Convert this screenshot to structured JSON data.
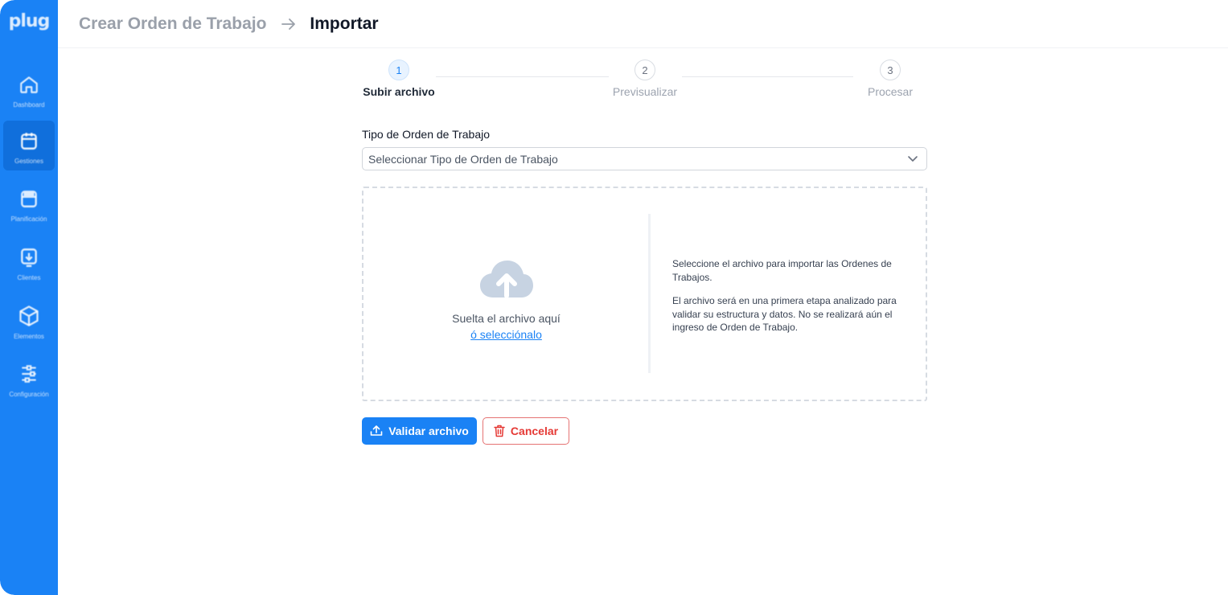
{
  "app": {
    "logo_text": "plug"
  },
  "sidebar": {
    "items": [
      {
        "label": "Dashboard",
        "icon": "home-icon",
        "active": false
      },
      {
        "label": "Gestiones",
        "icon": "calendar-icon",
        "active": true
      },
      {
        "label": "Planificación",
        "icon": "planning-icon",
        "active": false
      },
      {
        "label": "Clientes",
        "icon": "clients-icon",
        "active": false
      },
      {
        "label": "Elementos",
        "icon": "cube-icon",
        "active": false
      },
      {
        "label": "Configuración",
        "icon": "settings-icon",
        "active": false
      }
    ]
  },
  "header": {
    "breadcrumb_parent": "Crear Orden de Trabajo",
    "breadcrumb_current": "Importar",
    "separator_icon": "arrow-right-icon"
  },
  "stepper": {
    "steps": [
      {
        "number": "1",
        "label": "Subir archivo",
        "active": true
      },
      {
        "number": "2",
        "label": "Previsualizar",
        "active": false
      },
      {
        "number": "3",
        "label": "Procesar",
        "active": false
      }
    ]
  },
  "form": {
    "type_label": "Tipo de Orden de Trabajo",
    "type_placeholder": "Seleccionar Tipo de Orden de Trabajo"
  },
  "dropzone": {
    "icon": "cloud-upload-icon",
    "drop_text": "Suelta el archivo aquí",
    "select_link": "ó selecciónalo",
    "info_paragraph_1": "Seleccione el archivo para importar las Ordenes de Trabajos.",
    "info_paragraph_2": "El archivo será en una primera etapa analizado para validar su estructura y datos. No se realizará aún el ingreso de Orden de Trabajo."
  },
  "actions": {
    "validate_label": "Validar archivo",
    "cancel_label": "Cancelar"
  },
  "colors": {
    "primary": "#1a82f5",
    "danger": "#e53935",
    "sidebar": "#1a82f5"
  }
}
